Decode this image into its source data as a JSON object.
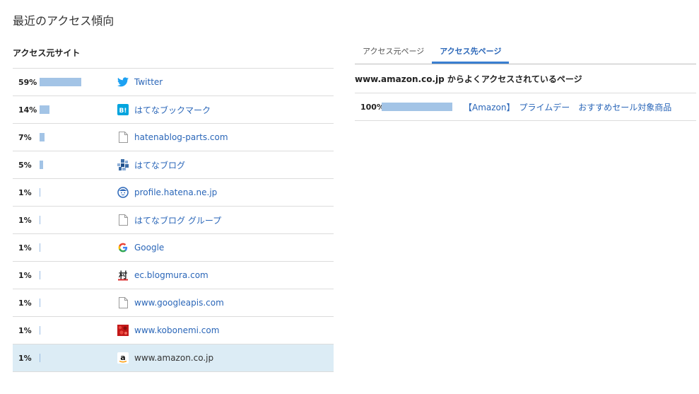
{
  "page": {
    "title": "最近のアクセス傾向"
  },
  "referrers": {
    "title": "アクセス元サイト",
    "rows": [
      {
        "percent": "59%",
        "share": 0.59,
        "label": "Twitter",
        "icon": "twitter-icon"
      },
      {
        "percent": "14%",
        "share": 0.14,
        "label": "はてなブックマーク",
        "icon": "hatena-bookmark-icon"
      },
      {
        "percent": "7%",
        "share": 0.07,
        "label": "hatenablog-parts.com",
        "icon": "document-icon"
      },
      {
        "percent": "5%",
        "share": 0.05,
        "label": "はてなブログ",
        "icon": "hatena-blog-icon"
      },
      {
        "percent": "1%",
        "share": 0.01,
        "label": "profile.hatena.ne.jp",
        "icon": "profile-face-icon"
      },
      {
        "percent": "1%",
        "share": 0.01,
        "label": "はてなブログ グループ",
        "icon": "document-icon"
      },
      {
        "percent": "1%",
        "share": 0.01,
        "label": "Google",
        "icon": "google-icon"
      },
      {
        "percent": "1%",
        "share": 0.01,
        "label": "ec.blogmura.com",
        "icon": "blogmura-icon"
      },
      {
        "percent": "1%",
        "share": 0.01,
        "label": "www.googleapis.com",
        "icon": "document-icon"
      },
      {
        "percent": "1%",
        "share": 0.01,
        "label": "www.kobonemi.com",
        "icon": "kobonemi-icon"
      },
      {
        "percent": "1%",
        "share": 0.01,
        "label": "www.amazon.co.jp",
        "icon": "amazon-icon"
      }
    ]
  },
  "tabs": [
    {
      "label": "アクセス元ページ"
    },
    {
      "label": "アクセス先ページ"
    }
  ],
  "destination": {
    "heading": "www.amazon.co.jp からよくアクセスされているページ",
    "rows": [
      {
        "percent": "100%",
        "share": 1.0,
        "label": "【Amazon】　プライムデー　おすすめセール対象商品"
      }
    ]
  },
  "colors": {
    "bar": "#a3c4e6",
    "link": "#2a66b8",
    "highlight": "#dcecf5",
    "tab_active": "#3a7fd1"
  }
}
